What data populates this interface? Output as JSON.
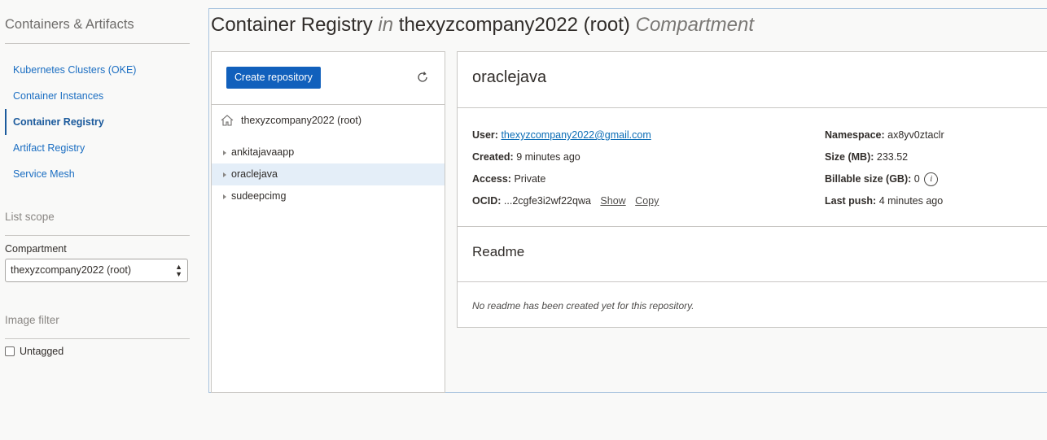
{
  "sidebar": {
    "title": "Containers & Artifacts",
    "items": [
      {
        "label": "Kubernetes Clusters (OKE)"
      },
      {
        "label": "Container Instances"
      },
      {
        "label": "Container Registry"
      },
      {
        "label": "Artifact Registry"
      },
      {
        "label": "Service Mesh"
      }
    ],
    "list_scope_label": "List scope",
    "compartment_label": "Compartment",
    "compartment_value": "thexyzcompany2022 (root)",
    "image_filter_label": "Image filter",
    "untagged_label": "Untagged"
  },
  "header": {
    "title_main": "Container Registry",
    "title_in": "in",
    "title_compartment": "thexyzcompany2022 (root)",
    "title_suffix": "Compartment"
  },
  "tree": {
    "create_button": "Create repository",
    "root_label": "thexyzcompany2022 (root)",
    "items": [
      {
        "label": "ankitajavaapp"
      },
      {
        "label": "oraclejava"
      },
      {
        "label": "sudeepcimg"
      }
    ],
    "selected_item": "oraclejava"
  },
  "detail": {
    "repo_name": "oraclejava",
    "user_label": "User:",
    "user_value": "thexyzcompany2022@gmail.com",
    "created_label": "Created:",
    "created_value": "9 minutes ago",
    "access_label": "Access:",
    "access_value": "Private",
    "ocid_label": "OCID:",
    "ocid_value": "...2cgfe3i2wf22qwa",
    "show_label": "Show",
    "copy_label": "Copy",
    "namespace_label": "Namespace:",
    "namespace_value": "ax8yv0ztaclr",
    "size_label": "Size (MB):",
    "size_value": "233.52",
    "billable_label": "Billable size (GB):",
    "billable_value": "0",
    "last_push_label": "Last push:",
    "last_push_value": "4 minutes ago",
    "readme_title": "Readme",
    "readme_empty": "No readme has been created yet for this repository."
  }
}
